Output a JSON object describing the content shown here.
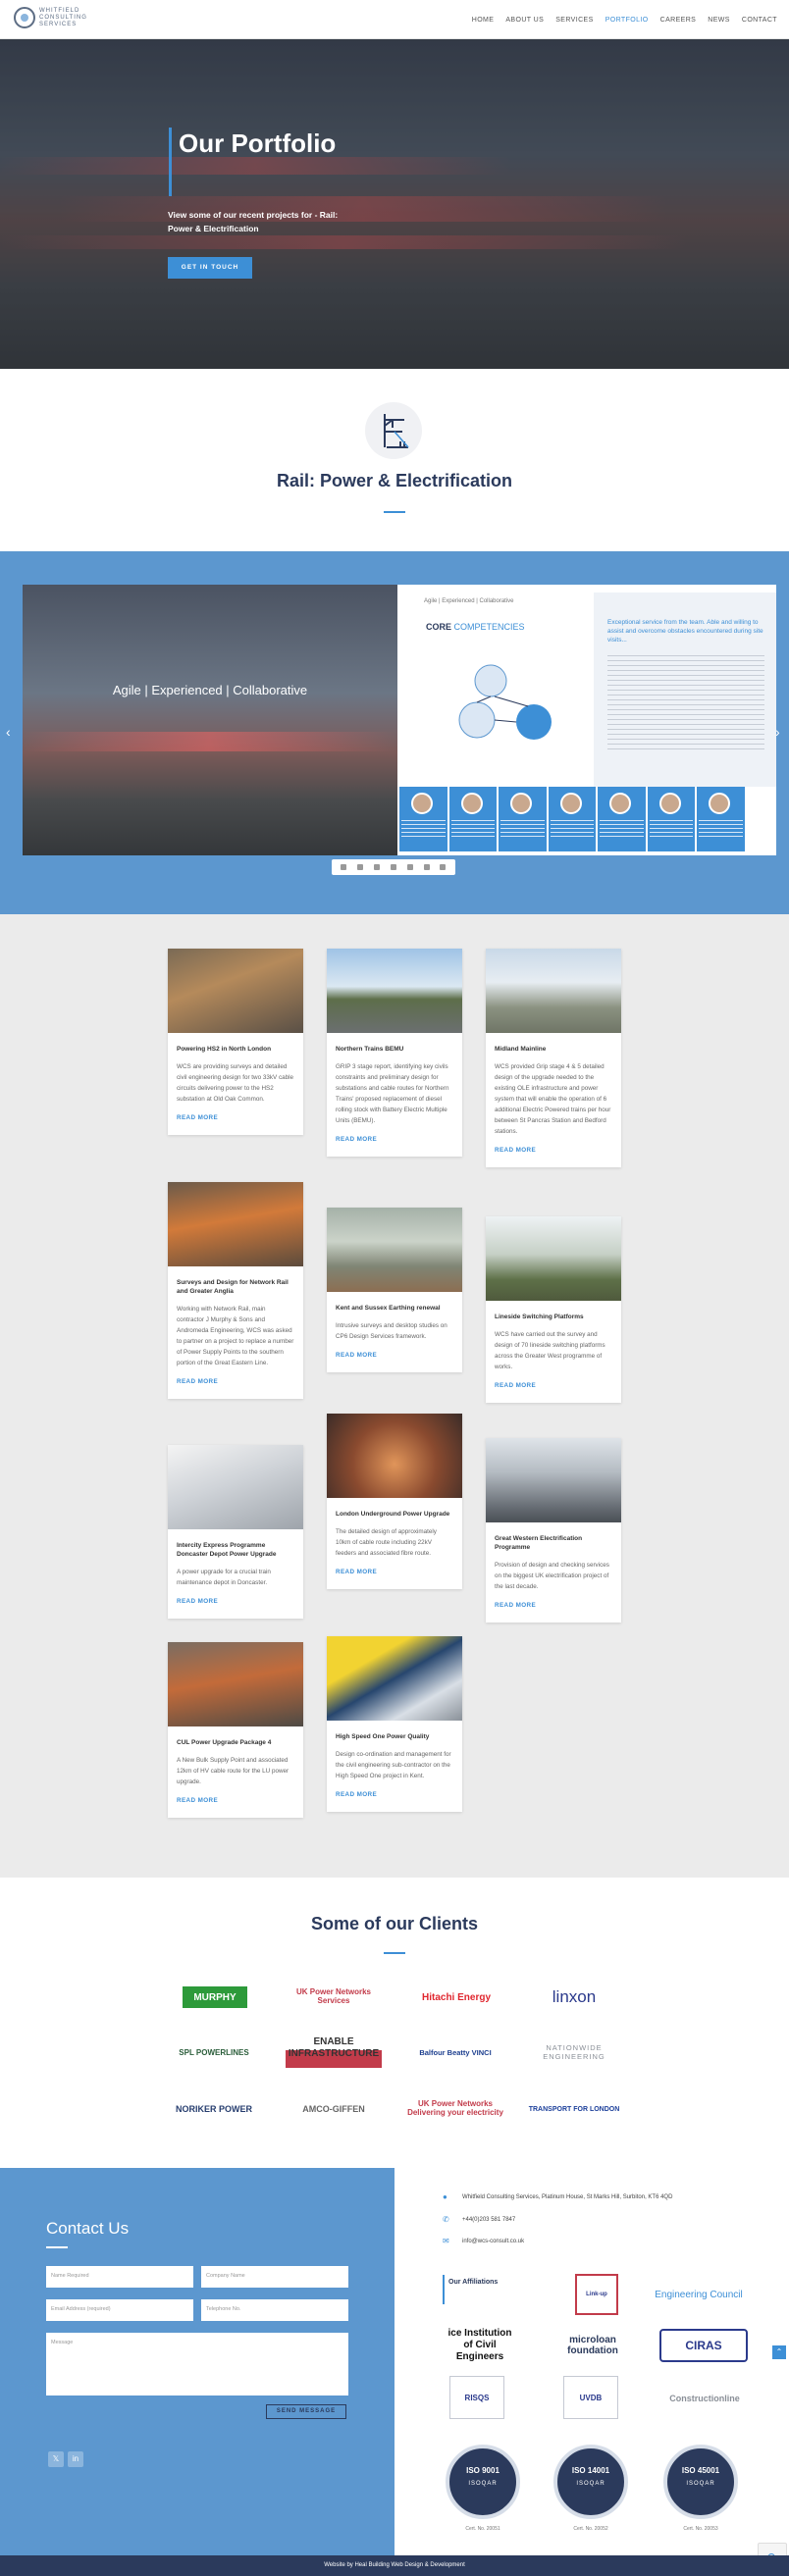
{
  "brand": {
    "logo_text": "WHITFIELD CONSULTING SERVICES",
    "accent": "#3d8fd6",
    "navy": "#2b3a5c",
    "band_blue": "#5c97cf"
  },
  "nav": {
    "items": [
      "HOME",
      "ABOUT US",
      "SERVICES",
      "PORTFOLIO",
      "CAREERS",
      "NEWS",
      "CONTACT"
    ],
    "active": "PORTFOLIO"
  },
  "hero": {
    "title": "Our Portfolio",
    "subtitle": "View some of our recent projects for - Rail: Power & Electrification",
    "button": "GET IN TOUCH"
  },
  "section": {
    "title": "Rail: Power & Electrification",
    "icon": "rail-overhead-line-icon"
  },
  "flipbook": {
    "image_caption": "Agile | Experienced | Collaborative",
    "doc_tag": "Agile | Experienced | Collaborative",
    "doc_heading_bold": "CORE",
    "doc_heading_rest": "COMPETENCIES",
    "quote": "Exceptional service from the team. Able and willing to assist and overcome obstacles encountered during site visits...",
    "prev_icon": "chevron-left-icon",
    "next_icon": "chevron-right-icon"
  },
  "projects": [
    {
      "title": "Powering HS2 in North London",
      "desc": "WCS are providing surveys and detailed civil engineering design for two 33kV cable circuits delivering power to the HS2 substation at Old Oak Common.",
      "link": "READ MORE"
    },
    {
      "title": "Northern Trains BEMU",
      "desc": "GRIP 3 stage report, identifying key civils constraints and preliminary design for substations and cable routes for Northern Trains' proposed replacement of diesel rolling stock with Battery Electric Multiple Units (BEMU).",
      "link": "READ MORE"
    },
    {
      "title": "Midland Mainline",
      "desc": "WCS provided Grip stage 4 & 5 detailed design of the upgrade needed to the existing OLE infrastructure and power system that will enable the operation of 6 additional Electric Powered trains per hour between St Pancras Station and Bedford stations.",
      "link": "READ MORE"
    },
    {
      "title": "Surveys and Design for Network Rail and Greater Anglia",
      "desc": "Working with Network Rail, main contractor J Murphy & Sons and Andromeda Engineering, WCS was asked to partner on a project to replace a number of Power Supply Points to the southern portion of the Great Eastern Line.",
      "link": "READ MORE"
    },
    {
      "title": "Kent and Sussex Earthing renewal",
      "desc": "Intrusive surveys and desktop studies on CP6 Design Services framework.",
      "link": "READ MORE"
    },
    {
      "title": "Lineside Switching Platforms",
      "desc": "WCS have carried out the survey and design of 70 lineside switching platforms across the Greater West programme of works.",
      "link": "READ MORE"
    },
    {
      "title": "Intercity Express Programme Doncaster Depot Power Upgrade",
      "desc": "A power upgrade for a crucial train maintenance depot in Doncaster.",
      "link": "READ MORE"
    },
    {
      "title": "London Underground Power Upgrade",
      "desc": "The detailed design of approximately 10km of cable route including 22kV feeders and associated fibre route.",
      "link": "READ MORE"
    },
    {
      "title": "Great Western Electrification Programme",
      "desc": "Provision of design and checking services on the biggest UK electrification project of the last decade.",
      "link": "READ MORE"
    },
    {
      "title": "CUL Power Upgrade Package 4",
      "desc": "A New Bulk Supply Point and associated 12km of HV cable route for the LU power upgrade.",
      "link": "READ MORE"
    },
    {
      "title": "High Speed One Power Quality",
      "desc": "Design co-ordination and management for the civil engineering sub-contractor on the High Speed One project in Kent.",
      "link": "READ MORE"
    }
  ],
  "clients": {
    "title": "Some of our Clients",
    "logos": [
      "MURPHY",
      "UK Power Networks Services",
      "Hitachi Energy",
      "linxon",
      "SPL POWERLINES",
      "ENABLE INFRASTRUCTURE",
      "Balfour Beatty VINCI",
      "NATIONWIDE ENGINEERING",
      "NORIKER POWER",
      "AMCO-GIFFEN",
      "UK Power Networks Delivering your electricity",
      "TRANSPORT FOR LONDON"
    ]
  },
  "contact": {
    "title": "Contact Us",
    "fields": {
      "name": "Name Required",
      "company": "Company Name",
      "email": "Email Address (required)",
      "phone": "Telephone No.",
      "message": "Message"
    },
    "send": "SEND MESSAGE"
  },
  "info": {
    "address": "Whitfield Consulting Services, Platinum House, St Marks Hill, Surbiton, KT6 4QD",
    "phone": "+44(0)203 581 7847",
    "email": "info@wcs-consult.co.uk"
  },
  "affiliations": {
    "title": "Our Affiliations",
    "logos": [
      "Link-up",
      "Engineering Council",
      "ice Institution of Civil Engineers",
      "microloan foundation",
      "CIRAS",
      "RISQS",
      "UVDB",
      "Constructionline"
    ],
    "badges": [
      {
        "std": "ISO 9001",
        "label": "ISOQAR"
      },
      {
        "std": "ISO 14001",
        "label": "ISOQAR"
      },
      {
        "std": "ISO 45001",
        "label": "ISOQAR"
      }
    ],
    "badge_caps": [
      "Cert. No. 20051",
      "Cert. No. 20052",
      "Cert. No. 20053"
    ]
  },
  "footer": {
    "text": "Website by Heal Building Web Design & Development"
  }
}
